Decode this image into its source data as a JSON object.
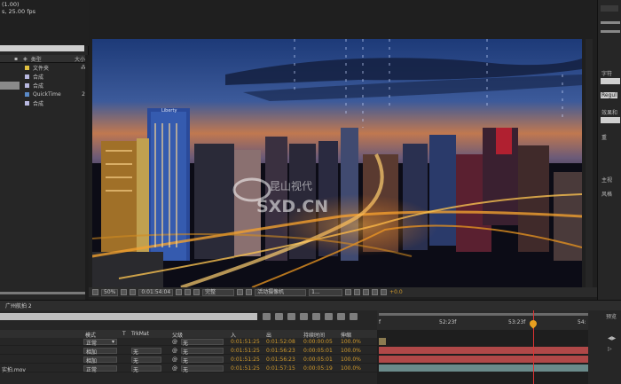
{
  "project": {
    "info_line1": "(1.00)",
    "info_line2": "s, 25.00 fps",
    "header_label": "类型",
    "header_size": "大小",
    "rows": [
      {
        "type": "文件夹",
        "size": "",
        "color": "#e0c040"
      },
      {
        "type": "合成",
        "size": "",
        "color": "#b8b8e0"
      },
      {
        "type": "合成",
        "size": "",
        "color": "#b8b8e0"
      },
      {
        "type": "QuickTime",
        "size": "2",
        "color": "#5a8ac8"
      },
      {
        "type": "合成",
        "size": "",
        "color": "#b8b8e0"
      }
    ]
  },
  "comp": {
    "toolbar": {
      "zoom": "50%",
      "timecode": "0:01:54:04",
      "resolution": "完整",
      "camera": "活动摄像机",
      "views": "1...",
      "exposure": "+0.0"
    },
    "watermark_cn": "昆山视代",
    "watermark_en": "SXD.CN",
    "billboard": "Liberty"
  },
  "right_panel": {
    "labels": [
      "字符",
      "Regul",
      "效果和",
      "重",
      "主视",
      "风格"
    ]
  },
  "timeline": {
    "tab": "广州航拍 2",
    "header": {
      "mode": "模式",
      "t": "T",
      "trkmat": "TrkMat",
      "parent": "父级",
      "in": "入",
      "out": "出",
      "duration": "持续时间",
      "stretch": "伸缩"
    },
    "layers": [
      {
        "name": "",
        "mode": "正常",
        "trkmat": "",
        "parent": "无",
        "in": "0:01:51:25",
        "out": "0:01:52:08",
        "duration": "0:00:00:05",
        "stretch": "100.0%"
      },
      {
        "name": "",
        "mode": "相加",
        "trkmat": "无",
        "parent": "无",
        "in": "0:01:51:25",
        "out": "0:01:56:23",
        "duration": "0:00:05:01",
        "stretch": "100.0%"
      },
      {
        "name": "",
        "mode": "相加",
        "trkmat": "无",
        "parent": "无",
        "in": "0:01:51:25",
        "out": "0:01:56:23",
        "duration": "0:00:05:01",
        "stretch": "100.0%"
      },
      {
        "name": "实拍.mov",
        "mode": "正常",
        "trkmat": "无",
        "parent": "无",
        "in": "0:01:51:25",
        "out": "0:01:57:15",
        "duration": "0:00:05:19",
        "stretch": "100.0%"
      }
    ],
    "ruler": {
      "start": "f",
      "mark1": "52:23f",
      "mark2": "53:23f",
      "end": "54:"
    },
    "far_right": {
      "label": "预览"
    }
  }
}
